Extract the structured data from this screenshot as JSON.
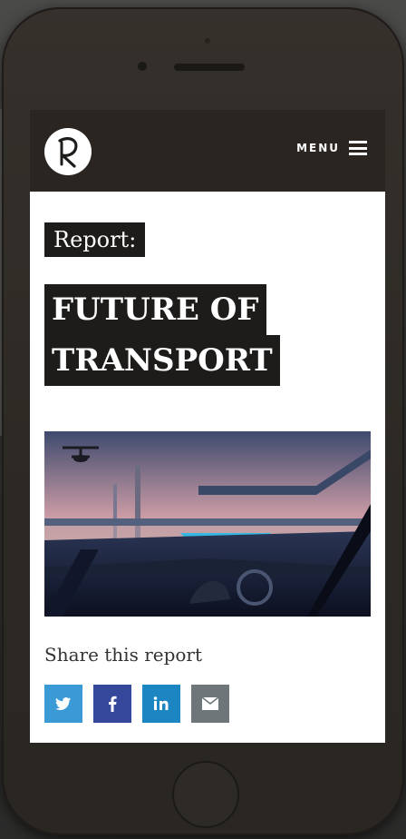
{
  "header": {
    "logo_alt": "R",
    "menu_label": "MENU"
  },
  "article": {
    "kicker": "Report:",
    "title_line_1": "FUTURE OF",
    "title_line_2": "TRANSPORT"
  },
  "share": {
    "label": "Share this report",
    "buttons": [
      {
        "network": "twitter",
        "icon": "twitter-icon",
        "color": "#3a9ad6"
      },
      {
        "network": "facebook",
        "icon": "facebook-icon",
        "color": "#34479a"
      },
      {
        "network": "linkedin",
        "icon": "linkedin-icon",
        "color": "#1c86c3"
      },
      {
        "network": "email",
        "icon": "mail-icon",
        "color": "#6e767a"
      }
    ]
  },
  "colors": {
    "header_bg": "#2a2521",
    "title_bg": "#1e1c1a",
    "page_bg": "#ffffff"
  }
}
